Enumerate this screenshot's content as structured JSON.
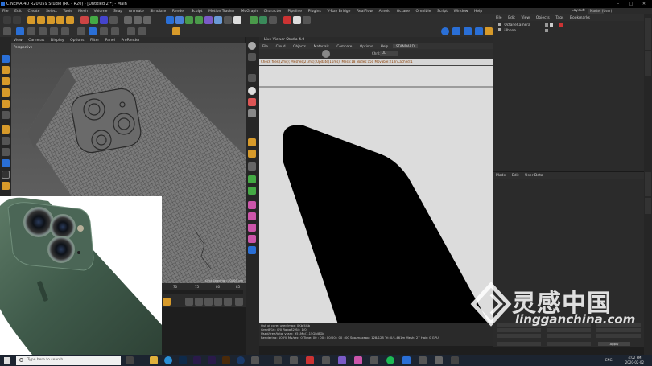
{
  "window": {
    "title": "CINEMA 4D R20.059 Studio (RC - R20) - [Untitled 2 *] - Main",
    "min_glyph": "–",
    "max_glyph": "□",
    "close_glyph": "✕"
  },
  "menubar": {
    "items": [
      "File",
      "Edit",
      "Create",
      "Select",
      "Tools",
      "Mesh",
      "Volume",
      "Snap",
      "Animate",
      "Simulate",
      "Render",
      "Sculpt",
      "Motion Tracker",
      "MoGraph",
      "Character",
      "Pipeline",
      "Plugins",
      "V-Ray Bridge",
      "RealFlow",
      "Arnold",
      "Octane",
      "Omnible",
      "Script",
      "Window",
      "Help"
    ],
    "layout_label": "Layout:",
    "layout_value": "Master (User)"
  },
  "viewport": {
    "menu": [
      "View",
      "Cameras",
      "Display",
      "Options",
      "Filter",
      "Panel",
      "ProRender"
    ],
    "label": "Perspective",
    "grid_spacing": "Grid Spacing : 10000 cm"
  },
  "timeline": {
    "ticks": [
      "70",
      "75",
      "80",
      "85",
      "90"
    ]
  },
  "live_viewer": {
    "title": "Live Viewer Studio 4.0",
    "menu": [
      "File",
      "Cloud",
      "Objects",
      "Materials",
      "Compare",
      "Options",
      "Help",
      "STANDARD"
    ],
    "channel_label": "Chnl:",
    "channel_value": "DL",
    "status": "Check files (2ms); Meshes(21ms); Update(11ms); Mesh:18 Nodes:150 Movable:21 InCached:1",
    "bottom_lines": [
      "Out of core: used/max: 0Kb/4Gb",
      "Grey8/16: 0/0     Rgba32/64: 1/0",
      "Used/free/total vram: 951Mb/7.15Gb/8Gb",
      "Rendering: 100%  Ms/sec: 0   Time: 00 : 00 : 00/00 : 00 : 00   Spp/maxspp: 128/128   Tri: 0/1.461m   Mesh: 27   Hair: 0   GPU:"
    ]
  },
  "objects_panel": {
    "menu": [
      "File",
      "Edit",
      "View",
      "Objects",
      "Tags",
      "Bookmarks"
    ],
    "rows": [
      "OctaneCamera",
      "iPhone"
    ]
  },
  "attributes_panel": {
    "menu": [
      "Mode",
      "Edit",
      "User Data"
    ]
  },
  "coordinates": {
    "apply_label": "Apply"
  },
  "taskbar": {
    "search_placeholder": "Type here to search",
    "lang": "ENG",
    "time": "4:02 PM",
    "date": "2020-02-02"
  },
  "watermark": {
    "chinese": "灵感中国",
    "english": "lingganchina.com"
  },
  "colors": {
    "accent_blue": "#2a6fd6",
    "render_bg": "#dcdcdc",
    "phone_green": "#3f5a4a",
    "status_orange": "#8a3d00"
  }
}
